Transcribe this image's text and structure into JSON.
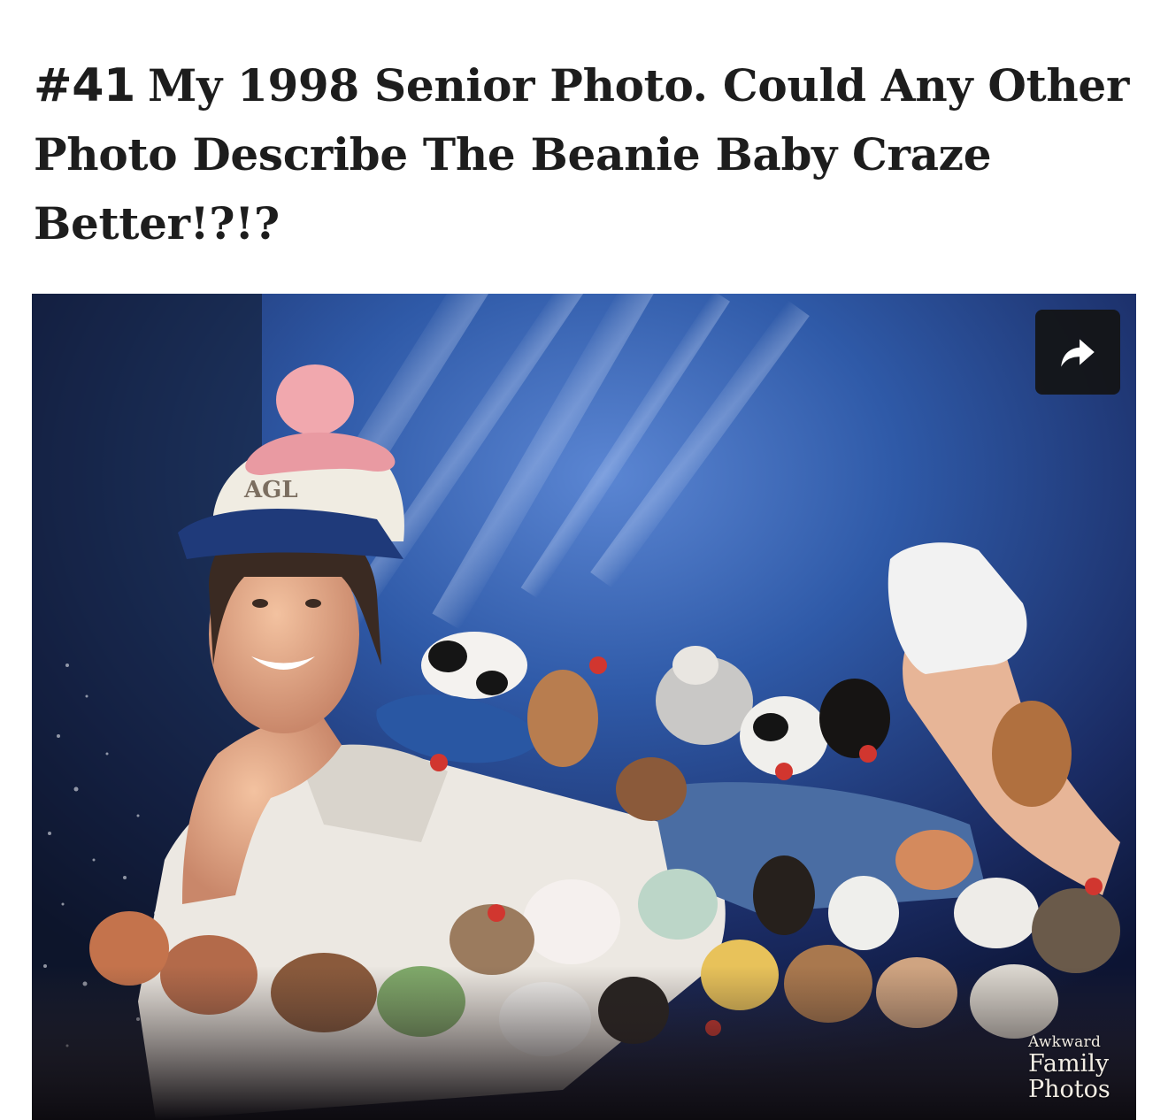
{
  "article": {
    "number": "#41",
    "title": "My 1998 Senior Photo. Could Any Other Photo Describe The Beanie Baby Craze Better!?!?"
  },
  "photo": {
    "alt": "",
    "watermark": {
      "line1": "Awkward",
      "line2": "Family",
      "line3": "Photos"
    }
  },
  "share": {
    "icon": "share-arrow-icon"
  },
  "colors": {
    "backdrop_blue": "#2f5aa8",
    "backdrop_dark": "#10183a",
    "share_button_bg": "#141414",
    "title_text": "#1d1d1d"
  }
}
